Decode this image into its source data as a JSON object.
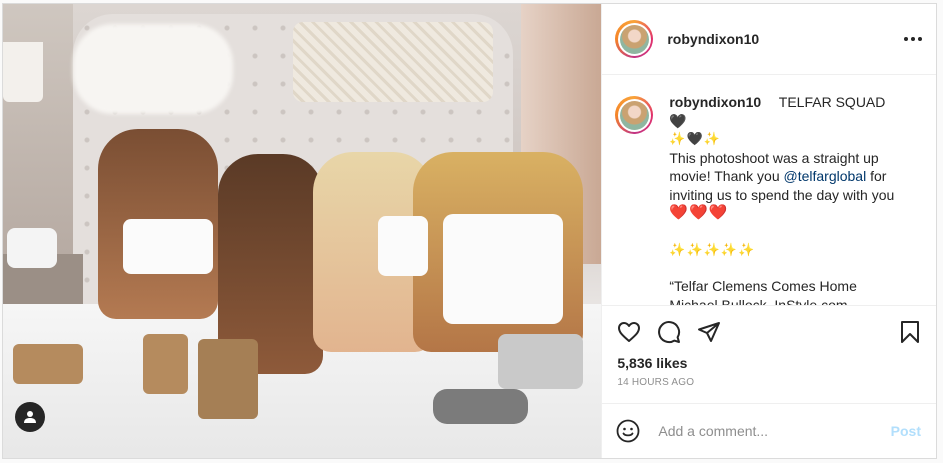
{
  "post": {
    "username": "robyndixon10",
    "caption": {
      "username": "robyndixon10",
      "line1_text": "TELFAR SQUAD",
      "line1_emoji": "🖤",
      "line2_emoji": "✨🖤✨",
      "line3": "This photoshoot was a straight up",
      "line4": "movie! Thank you ",
      "mention": "@telfarglobal",
      "line4_end": " for",
      "line5": "inviting us to spend the day with you",
      "line6_emoji": "❤️❤️❤️",
      "line7_emoji": "✨✨✨✨✨",
      "line8": "“Telfar Clemens Comes Home",
      "line9": "Michael Bullock, InStyle.com"
    },
    "likes": "5,836 likes",
    "timestamp": "14 HOURS AGO",
    "comment_placeholder": "Add a comment...",
    "post_button": "Post"
  },
  "icons": {
    "user_tag": "user-icon",
    "more": "more-options-icon",
    "like": "heart-icon",
    "comment": "comment-icon",
    "share": "paper-plane-icon",
    "save": "bookmark-icon",
    "emoji": "smiley-icon"
  },
  "colors": {
    "text": "#262626",
    "muted": "#8e8e8e",
    "link": "#00376b",
    "post_button": "#b2dffc",
    "heart": "#ed4956"
  }
}
